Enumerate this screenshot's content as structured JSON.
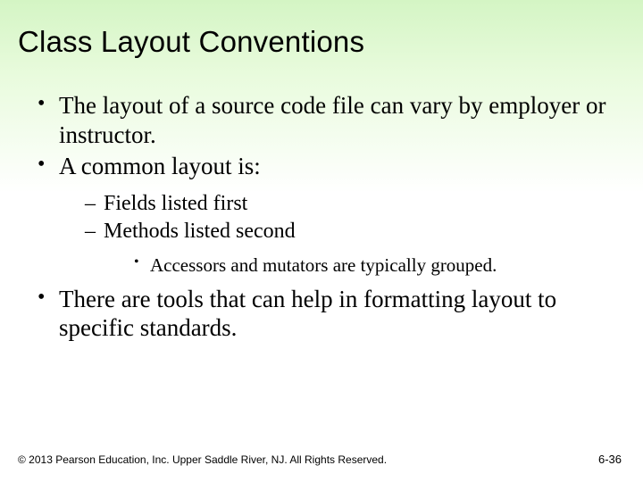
{
  "title": "Class Layout Conventions",
  "bullets": {
    "b1": "The layout of a source code file can vary by employer or instructor.",
    "b2": "A common layout is:",
    "b2_sub": {
      "s1": "Fields listed first",
      "s2": "Methods listed second",
      "s2_sub": {
        "t1": "Accessors and mutators are typically grouped."
      }
    },
    "b3": "There are tools that can help in formatting layout to specific standards."
  },
  "footer": {
    "copyright": "© 2013 Pearson Education, Inc. Upper Saddle River, NJ. All Rights Reserved.",
    "page": "6-36"
  }
}
